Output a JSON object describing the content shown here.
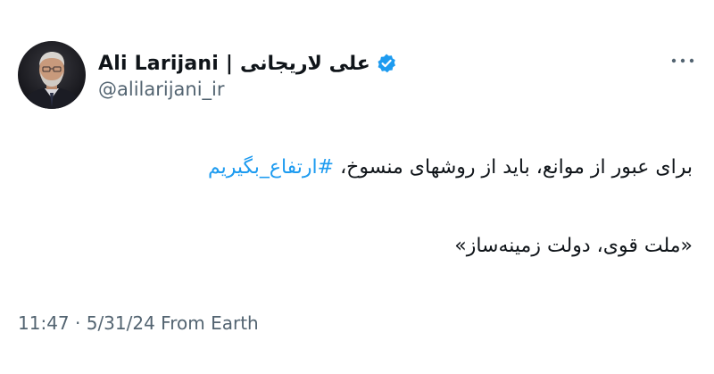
{
  "tweet": {
    "author": {
      "display_name": "Ali Larijani | علی لاریجانی",
      "handle": "@alilarijani_ir",
      "verified_icon": "verified-badge-icon",
      "avatar": "profile-photo"
    },
    "more_icon": "more-horizontal-icon",
    "body": {
      "line1_text": "برای عبور از موانع، باید از روشهای منسوخ، ",
      "line1_hashtag": "#ارتفاع_بگیریم",
      "line2_text": "«ملت قوی، دولت زمینه‌ساز»"
    },
    "meta": {
      "time": "11:47",
      "separator": " · ",
      "date": "5/31/24",
      "source": " From Earth"
    },
    "colors": {
      "text": "#0f1419",
      "secondary": "#536471",
      "link": "#1d9bf0",
      "verified": "#1d9bf0"
    }
  }
}
